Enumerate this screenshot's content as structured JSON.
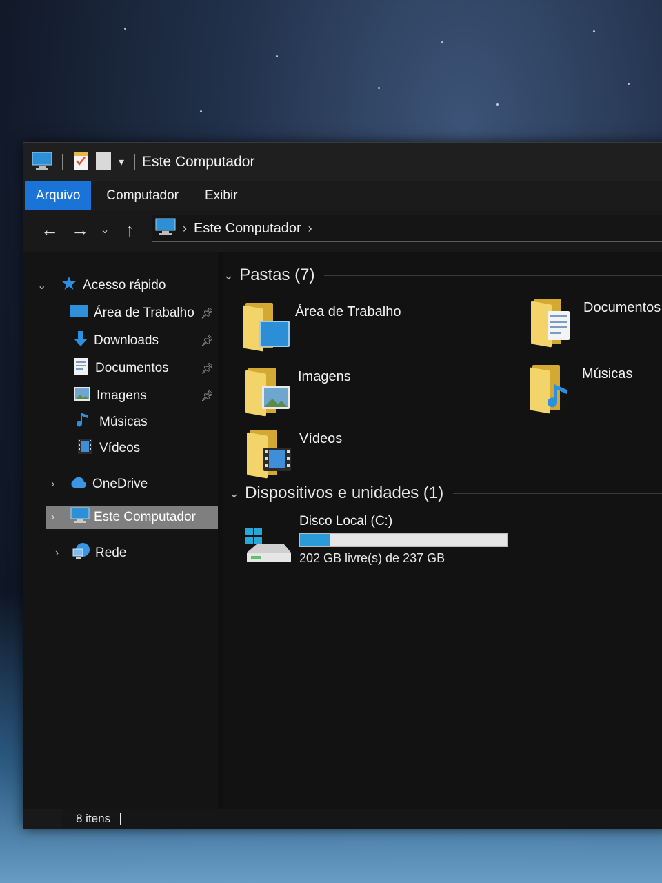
{
  "window": {
    "title": "Este Computador"
  },
  "ribbon": {
    "tabs": [
      {
        "label": "Arquivo",
        "active": true
      },
      {
        "label": "Computador",
        "active": false
      },
      {
        "label": "Exibir",
        "active": false
      }
    ]
  },
  "navigation": {
    "back_icon": "arrow-left-icon",
    "forward_icon": "arrow-right-icon",
    "recent_icon": "chevron-down-icon",
    "up_icon": "arrow-up-icon",
    "address": {
      "path_label": "Este Computador",
      "separator": "›"
    }
  },
  "sidebar": {
    "quick_access": {
      "label": "Acesso rápido",
      "items": [
        {
          "label": "Área de Trabalho",
          "pinned": true
        },
        {
          "label": "Downloads",
          "pinned": true
        },
        {
          "label": "Documentos",
          "pinned": true
        },
        {
          "label": "Imagens",
          "pinned": true
        },
        {
          "label": "Músicas",
          "pinned": false
        },
        {
          "label": "Vídeos",
          "pinned": false
        }
      ]
    },
    "onedrive": {
      "label": "OneDrive"
    },
    "this_pc": {
      "label": "Este Computador",
      "selected": true
    },
    "network": {
      "label": "Rede"
    }
  },
  "content": {
    "folders_group": {
      "title": "Pastas (7)",
      "folders": [
        {
          "label": "Área de Trabalho",
          "icon": "desktop-folder-icon"
        },
        {
          "label": "Documentos",
          "icon": "documents-folder-icon"
        },
        {
          "label": "Imagens",
          "icon": "pictures-folder-icon"
        },
        {
          "label": "Músicas",
          "icon": "music-folder-icon"
        },
        {
          "label": "Vídeos",
          "icon": "videos-folder-icon"
        }
      ]
    },
    "devices_group": {
      "title": "Dispositivos e unidades (1)",
      "drives": [
        {
          "label": "Disco Local (C:)",
          "free_text": "202 GB livre(s) de 237 GB",
          "used_fraction": 0.148
        }
      ]
    }
  },
  "status": {
    "item_count": "8 itens"
  },
  "colors": {
    "accent": "#1a73d6",
    "folder_yellow": "#f3d46a",
    "drive_fill": "#2a9bd8",
    "window_bg": "#191919"
  }
}
